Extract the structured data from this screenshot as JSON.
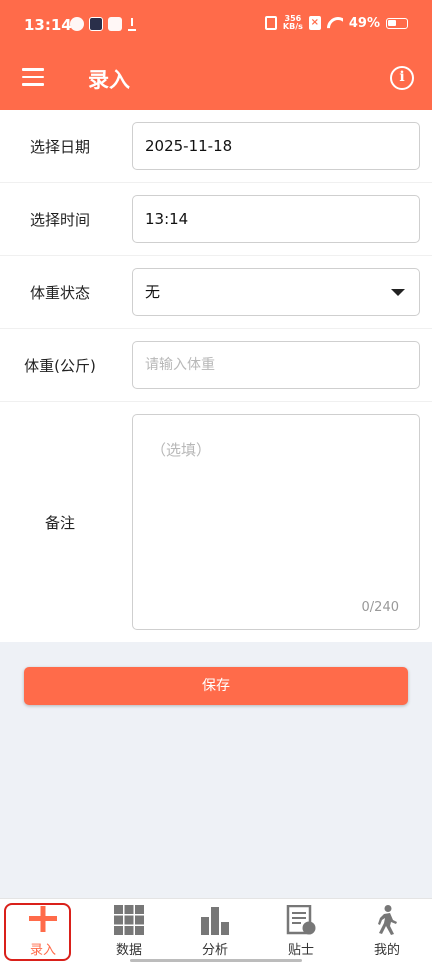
{
  "status_bar": {
    "time": "13:14",
    "net_speed_value": "356",
    "net_speed_unit": "KB/s",
    "battery_percent": "49%",
    "battery_level": 0.49,
    "icons": [
      "check-circle-icon",
      "video-app-icon",
      "app-notification-icon",
      "download-icon",
      "vibrate-icon",
      "sim-off-icon",
      "wifi-icon",
      "battery-icon"
    ]
  },
  "app_bar": {
    "title": "录入",
    "icons": [
      "menu-icon",
      "info-icon"
    ]
  },
  "form": {
    "date_label": "选择日期",
    "date_value": "2025-11-18",
    "time_label": "选择时间",
    "time_value": "13:14",
    "state_label": "体重状态",
    "state_value": "无",
    "weight_label": "体重(公斤)",
    "weight_placeholder": "请输入体重",
    "note_label": "备注",
    "note_placeholder": "（选填）",
    "note_counter": "0/240"
  },
  "actions": {
    "save_label": "保存"
  },
  "bottom_nav": {
    "items": [
      {
        "label": "录入",
        "icon": "plus-icon",
        "active": true
      },
      {
        "label": "数据",
        "icon": "grid-icon",
        "active": false
      },
      {
        "label": "分析",
        "icon": "bar-chart-icon",
        "active": false
      },
      {
        "label": "贴士",
        "icon": "tips-document-icon",
        "active": false
      },
      {
        "label": "我的",
        "icon": "walking-person-icon",
        "active": false
      }
    ]
  },
  "colors": {
    "accent": "#ff6b4a",
    "background": "#eef1f6",
    "active_highlight": "#d9201a"
  }
}
